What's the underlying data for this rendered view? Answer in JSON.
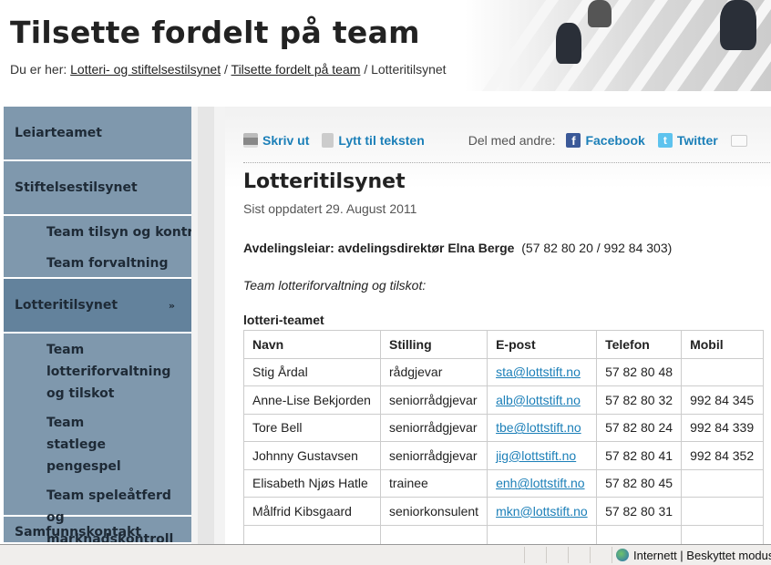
{
  "header": {
    "title": "Tilsette fordelt på team",
    "breadcrumb_prefix": "Du er her:",
    "breadcrumb": [
      "Lotteri- og stiftelsestilsynet",
      "Tilsette fordelt på team",
      "Lotteritilsynet"
    ],
    "breadcrumb_sep": "/"
  },
  "sidebar": {
    "items": [
      {
        "label": "Leiarteamet"
      },
      {
        "label": "Stiftelsestilsynet"
      },
      {
        "label": "Team tilsyn og kontroll"
      },
      {
        "label": "Team forvaltning"
      },
      {
        "label": "Lotteritilsynet",
        "marker": "»"
      },
      {
        "label": "Team lotteriforvaltning og tilskot"
      },
      {
        "label": "Team statlege pengespel"
      },
      {
        "label": "Team speleåtferd og marknadskontroll"
      },
      {
        "label": "Samfunnskontakt"
      }
    ]
  },
  "toolbar": {
    "print": "Skriv ut",
    "listen": "Lytt til teksten",
    "share_label": "Del med andre:",
    "facebook": "Facebook",
    "twitter": "Twitter"
  },
  "article": {
    "title": "Lotteritilsynet",
    "updated": "Sist oppdatert 29. August 2011",
    "leader_bold": "Avdelingsleiar: avdelingsdirektør Elna Berge",
    "leader_phone": "(57 82 80 20 / 992 84 303)",
    "team_heading": "Team lotteriforvaltning og tilskot:",
    "table_caption": "lotteri-teamet"
  },
  "table": {
    "headers": [
      "Navn",
      "Stilling",
      "E-post",
      "Telefon",
      "Mobil"
    ],
    "rows": [
      [
        "Stig Årdal",
        "rådgjevar",
        "sta@lottstift.no",
        "57 82 80 48",
        ""
      ],
      [
        "Anne-Lise Bekjorden",
        "seniorrådgjevar",
        "alb@lottstift.no",
        "57 82 80 32",
        "992 84 345"
      ],
      [
        "Tore Bell",
        "seniorrådgjevar",
        "tbe@lottstift.no",
        "57 82 80 24",
        "992 84 339"
      ],
      [
        "Johnny Gustavsen",
        "seniorrådgjevar",
        "jig@lottstift.no",
        "57 82 80 41",
        "992 84 352"
      ],
      [
        "Elisabeth Njøs Hatle",
        "trainee",
        "enh@lottstift.no",
        "57 82 80 45",
        ""
      ],
      [
        "Målfrid Kibsgaard",
        "seniorkonsulent",
        "mkn@lottstift.no",
        "57 82 80 31",
        ""
      ],
      [
        "",
        "",
        "",
        "",
        ""
      ]
    ]
  },
  "statusbar": {
    "zone": "Internett | Beskyttet modus: P"
  },
  "colors": {
    "sidebar": "#7f98ad",
    "sidebar_active": "#63829c",
    "link": "#1b7fb8"
  }
}
